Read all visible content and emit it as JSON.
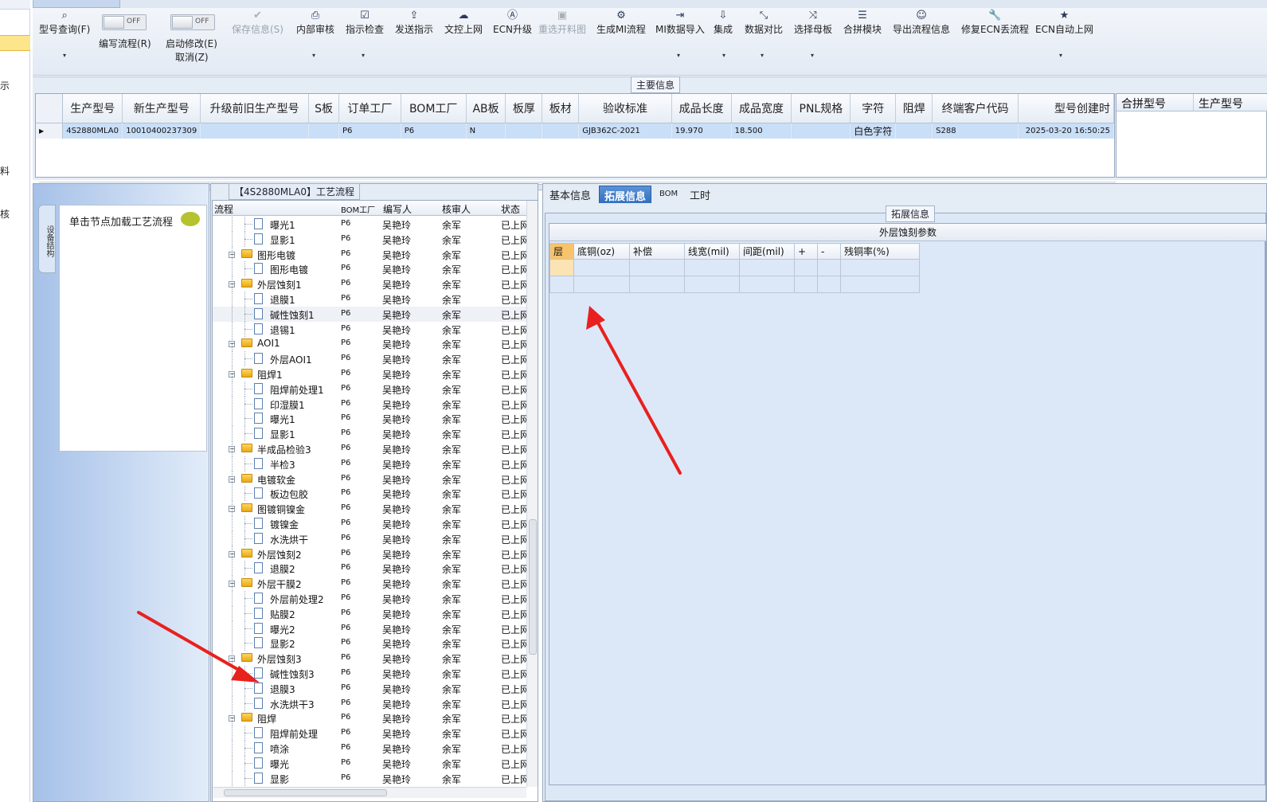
{
  "left_strip": {
    "items": [
      "示",
      "料",
      "核"
    ]
  },
  "ribbon": {
    "buttons": [
      {
        "id": "query",
        "label": "型号查询(F)",
        "icon": "search-icon"
      },
      {
        "id": "save",
        "label": "保存信息(S)",
        "icon": "check-icon"
      },
      {
        "id": "internal_review",
        "label": "内部审核",
        "icon": "printer-icon"
      },
      {
        "id": "instruction_check",
        "label": "指示检查",
        "icon": "checkbox-icon"
      },
      {
        "id": "send_instruction",
        "label": "发送指示",
        "icon": "upload-icon"
      },
      {
        "id": "doc_online",
        "label": "文控上网",
        "icon": "cloud-icon"
      },
      {
        "id": "ecn_upgrade",
        "label": "ECN升级",
        "icon": "a-icon"
      },
      {
        "id": "reselect_material",
        "label": "重选开料图",
        "icon": "image-icon"
      },
      {
        "id": "gen_mi",
        "label": "生成MI流程",
        "icon": "gears-icon"
      },
      {
        "id": "mi_import",
        "label": "MI数据导入",
        "icon": "login-icon"
      },
      {
        "id": "integrate",
        "label": "集成",
        "icon": "download-icon"
      },
      {
        "id": "data_compare",
        "label": "数据对比",
        "icon": "compress-icon"
      },
      {
        "id": "select_master",
        "label": "选择母板",
        "icon": "shuffle-icon"
      },
      {
        "id": "merge_module",
        "label": "合拼模块",
        "icon": "list-icon"
      },
      {
        "id": "export_flow",
        "label": "导出流程信息",
        "icon": "smile-icon"
      },
      {
        "id": "fix_ecn",
        "label": "修复ECN丢流程",
        "icon": "wrench-icon"
      },
      {
        "id": "ecn_auto",
        "label": "ECN自动上网",
        "icon": "star-icon"
      }
    ],
    "toggle_off": "OFF",
    "write_flow_label": "编写流程(R)",
    "start_modify_label": "启动修改(E)",
    "cancel_label": "取消(Z)"
  },
  "main_info": {
    "title": "主要信息",
    "columns": [
      "生产型号",
      "新生产型号",
      "升级前旧生产型号",
      "S板",
      "订单工厂",
      "BOM工厂",
      "AB板",
      "板厚",
      "板材",
      "验收标准",
      "成品长度",
      "成品宽度",
      "PNL规格",
      "字符",
      "阻焊",
      "终端客户代码",
      "型号创建时"
    ],
    "row": [
      "4S2880MLA0",
      "10010400237309",
      "",
      "",
      "P6",
      "P6",
      "N",
      "",
      "",
      "GJB362C-2021",
      "19.970",
      "18.500",
      "",
      "白色字符",
      "",
      "S288",
      "2025-03-20 16:50:25"
    ],
    "right_columns": [
      "合拼型号",
      "生产型号"
    ]
  },
  "nav": {
    "vtab": "设备结构",
    "hint": "单击节点加载工艺流程"
  },
  "flow": {
    "title": "【4S2880MLA0】工艺流程",
    "columns": [
      "流程",
      "BOM工厂",
      "编写人",
      "核审人",
      "状态"
    ],
    "factory": "P6",
    "writer": "吴艳玲",
    "reviewer": "余军",
    "status": "已上网",
    "rows": [
      {
        "name": "曝光1",
        "level": 2
      },
      {
        "name": "显影1",
        "level": 2
      },
      {
        "name": "图形电镀",
        "level": 1
      },
      {
        "name": "图形电镀",
        "level": 2
      },
      {
        "name": "外层蚀刻1",
        "level": 1
      },
      {
        "name": "退膜1",
        "level": 2
      },
      {
        "name": "碱性蚀刻1",
        "level": 2,
        "highlight": true
      },
      {
        "name": "退锡1",
        "level": 2
      },
      {
        "name": "AOI1",
        "level": 1
      },
      {
        "name": "外层AOI1",
        "level": 2
      },
      {
        "name": "阻焊1",
        "level": 1
      },
      {
        "name": "阻焊前处理1",
        "level": 2
      },
      {
        "name": "印湿膜1",
        "level": 2
      },
      {
        "name": "曝光1",
        "level": 2
      },
      {
        "name": "显影1",
        "level": 2
      },
      {
        "name": "半成品检验3",
        "level": 1
      },
      {
        "name": "半检3",
        "level": 2
      },
      {
        "name": "电镀软金",
        "level": 1
      },
      {
        "name": "板边包胶",
        "level": 2
      },
      {
        "name": "图镀铜镍金",
        "level": 1
      },
      {
        "name": "镀镍金",
        "level": 2
      },
      {
        "name": "水洗烘干",
        "level": 2
      },
      {
        "name": "外层蚀刻2",
        "level": 1
      },
      {
        "name": "退膜2",
        "level": 2
      },
      {
        "name": "外层干膜2",
        "level": 1
      },
      {
        "name": "外层前处理2",
        "level": 2
      },
      {
        "name": "贴膜2",
        "level": 2
      },
      {
        "name": "曝光2",
        "level": 2
      },
      {
        "name": "显影2",
        "level": 2
      },
      {
        "name": "外层蚀刻3",
        "level": 1
      },
      {
        "name": "碱性蚀刻3",
        "level": 2
      },
      {
        "name": "退膜3",
        "level": 2
      },
      {
        "name": "水洗烘干3",
        "level": 2
      },
      {
        "name": "阻焊",
        "level": 1
      },
      {
        "name": "阻焊前处理",
        "level": 2
      },
      {
        "name": "喷涂",
        "level": 2
      },
      {
        "name": "曝光",
        "level": 2
      },
      {
        "name": "显影",
        "level": 2
      }
    ]
  },
  "right": {
    "tabs": [
      "基本信息",
      "拓展信息",
      "BOM",
      "工时"
    ],
    "active_tab": "拓展信息",
    "section_title": "拓展信息",
    "etch_title": "外层蚀刻参数",
    "etch_columns": [
      "层",
      "底铜(oz)",
      "补偿",
      "线宽(mil)",
      "间距(mil)",
      "+",
      "-",
      "残铜率(%)"
    ]
  },
  "annotations": {
    "arrow_color": "#e8211e"
  }
}
